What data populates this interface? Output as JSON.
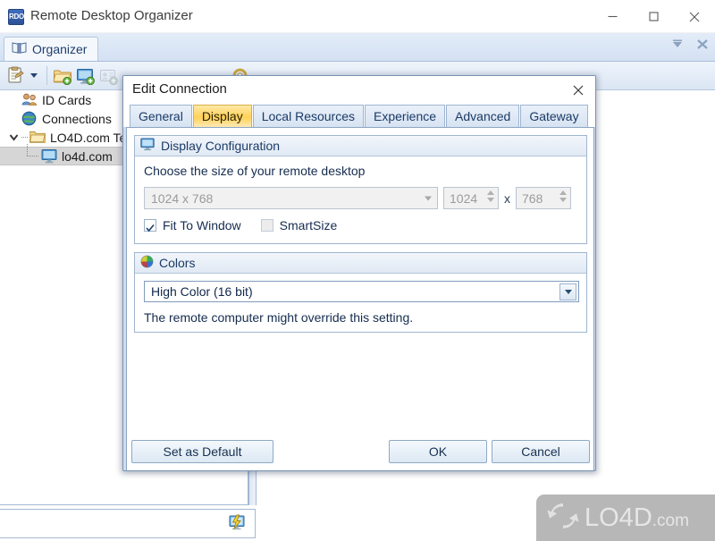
{
  "window": {
    "title": "Remote Desktop Organizer",
    "app_icon_text": "RDO",
    "controls": {
      "minimize": "minimize-icon",
      "maximize": "maximize-icon",
      "close": "close-icon"
    }
  },
  "ribbon": {
    "tabs": [
      {
        "label": "Organizer",
        "icon": "book-icon",
        "active": true
      }
    ],
    "right_icons": [
      "collapse-ribbon-icon",
      "close-ribbon-icon"
    ]
  },
  "toolbar": {
    "items": [
      {
        "name": "edit-properties-button",
        "icon": "clipboard-icon",
        "has_dropdown": true
      },
      {
        "name": "new-folder-button",
        "icon": "folder-add-icon"
      },
      {
        "name": "new-connection-button",
        "icon": "monitor-add-icon"
      },
      {
        "name": "new-id-card-button",
        "icon": "idcard-add-icon",
        "disabled": true
      },
      {
        "name": "settings-button",
        "icon": "gear-icon"
      }
    ]
  },
  "tree": {
    "items": [
      {
        "label": "ID Cards",
        "icon": "people-icon",
        "level": 0,
        "expander": "none",
        "selected": false
      },
      {
        "label": "Connections",
        "icon": "globe-icon",
        "level": 0,
        "expander": "none",
        "selected": false
      },
      {
        "label": "LO4D.com Te",
        "icon": "folder-icon",
        "level": 1,
        "expander": "expanded",
        "selected": false
      },
      {
        "label": "lo4d.com",
        "icon": "monitor-icon",
        "level": 2,
        "expander": "none",
        "selected": true
      }
    ]
  },
  "statusbar": {
    "icon": "remote-desktop-status-icon",
    "text": ""
  },
  "watermark": {
    "main": "LO4D",
    "suffix": ".com",
    "icon": "lo4d-arrows-icon"
  },
  "dialog": {
    "title": "Edit Connection",
    "close_label": "close-icon",
    "tabs": [
      {
        "label": "General",
        "active": false
      },
      {
        "label": "Display",
        "active": true
      },
      {
        "label": "Local Resources",
        "active": false
      },
      {
        "label": "Experience",
        "active": false
      },
      {
        "label": "Advanced",
        "active": false
      },
      {
        "label": "Gateway",
        "active": false
      }
    ],
    "display_group": {
      "title": "Display Configuration",
      "icon": "monitor-icon",
      "prompt": "Choose the size of your remote desktop",
      "resolution_combo": {
        "value": "1024 x 768",
        "enabled": false
      },
      "width_spinner": {
        "value": "1024",
        "enabled": false
      },
      "separator": "x",
      "height_spinner": {
        "value": "768",
        "enabled": false
      },
      "checkboxes": [
        {
          "label": "Fit To Window",
          "checked": true,
          "enabled": true
        },
        {
          "label": "SmartSize",
          "checked": false,
          "enabled": false
        }
      ]
    },
    "colors_group": {
      "title": "Colors",
      "icon": "color-wheel-icon",
      "combo": {
        "value": "High Color (16 bit)",
        "enabled": true
      },
      "note": "The remote computer might override this setting."
    },
    "footer": {
      "set_default": "Set as Default",
      "ok": "OK",
      "cancel": "Cancel"
    }
  },
  "colors": {
    "accent": "#2b5296",
    "dialog_bg": "#cfdcef",
    "active_tab": "#ffd257",
    "selection": "#d6d6d6",
    "watermark_bg": "#b7b7b7"
  }
}
